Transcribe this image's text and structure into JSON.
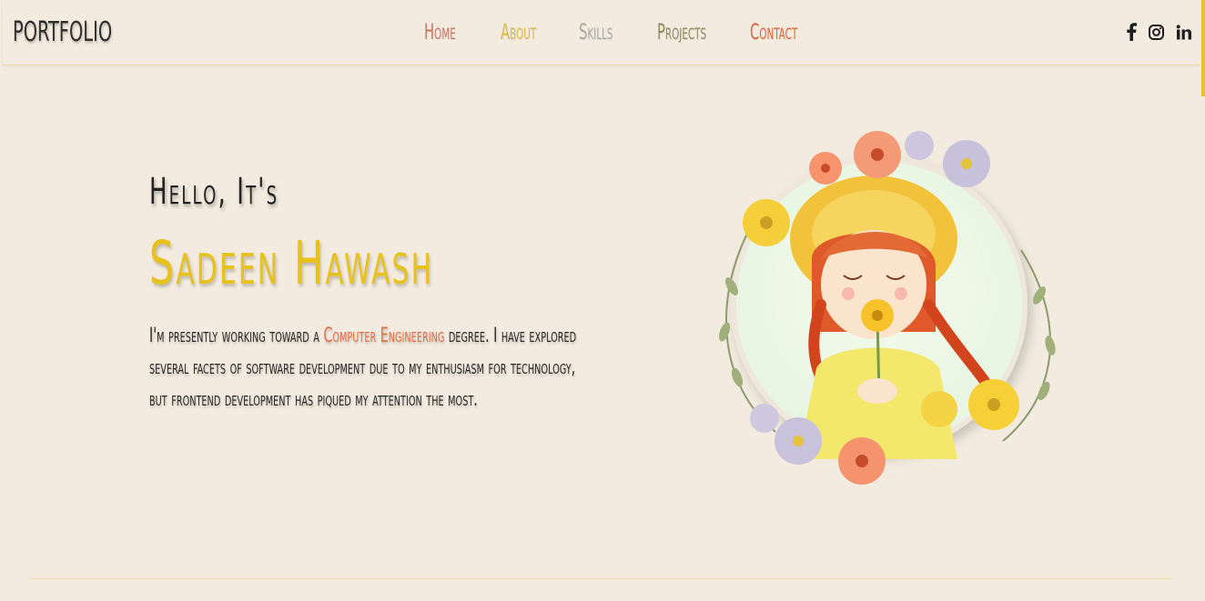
{
  "header": {
    "logo": "PORTFOLIO",
    "nav": [
      {
        "label": "Home",
        "color": "#c8776a"
      },
      {
        "label": "About",
        "color": "#dcba45"
      },
      {
        "label": "Skills",
        "color": "#a9a9a9"
      },
      {
        "label": "Projects",
        "color": "#8c8a5c"
      },
      {
        "label": "Contact",
        "color": "#da6a42"
      }
    ],
    "social": [
      "facebook-icon",
      "instagram-icon",
      "linkedin-icon"
    ]
  },
  "hero": {
    "greeting": "Hello, It's",
    "name": "Sadeen Hawash",
    "bio_before": "I'm presently working toward a ",
    "bio_highlight": "Computer Engineering",
    "bio_after": " degree. I have explored several facets of software development due to my enthusiasm for technology, but frontend development has piqued my attention the most."
  },
  "colors": {
    "background": "#f3ebdf",
    "accent": "#e7c21c",
    "highlight": "#de6e45"
  }
}
